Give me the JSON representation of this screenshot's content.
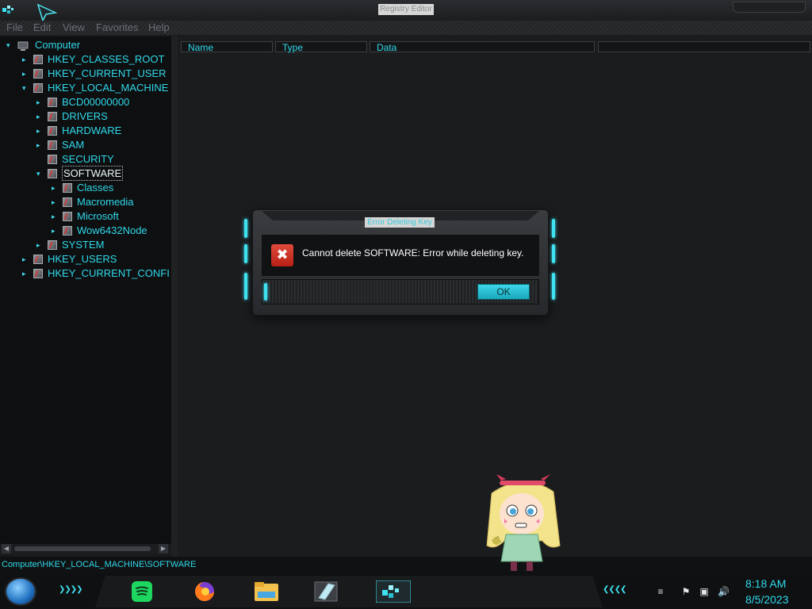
{
  "window": {
    "title": "Registry Editor"
  },
  "menu": {
    "items": [
      "File",
      "Edit",
      "View",
      "Favorites",
      "Help"
    ]
  },
  "tree": {
    "root": "Computer",
    "items": [
      {
        "label": "HKEY_CLASSES_ROOT",
        "depth": 1,
        "expanded": false
      },
      {
        "label": "HKEY_CURRENT_USER",
        "depth": 1,
        "expanded": false
      },
      {
        "label": "HKEY_LOCAL_MACHINE",
        "depth": 1,
        "expanded": true
      },
      {
        "label": "BCD00000000",
        "depth": 2,
        "expanded": false
      },
      {
        "label": "DRIVERS",
        "depth": 2,
        "expanded": false
      },
      {
        "label": "HARDWARE",
        "depth": 2,
        "expanded": false
      },
      {
        "label": "SAM",
        "depth": 2,
        "expanded": false
      },
      {
        "label": "SECURITY",
        "depth": 2,
        "expanded": false
      },
      {
        "label": "SOFTWARE",
        "depth": 2,
        "expanded": true,
        "selected": true
      },
      {
        "label": "Classes",
        "depth": 3,
        "expanded": false
      },
      {
        "label": "Macromedia",
        "depth": 3,
        "expanded": false
      },
      {
        "label": "Microsoft",
        "depth": 3,
        "expanded": false
      },
      {
        "label": "Wow6432Node",
        "depth": 3,
        "expanded": false
      },
      {
        "label": "SYSTEM",
        "depth": 2,
        "expanded": false
      },
      {
        "label": "HKEY_USERS",
        "depth": 1,
        "expanded": false
      },
      {
        "label": "HKEY_CURRENT_CONFI",
        "depth": 1,
        "expanded": false
      }
    ]
  },
  "list": {
    "columns": [
      "Name",
      "Type",
      "Data"
    ]
  },
  "status": {
    "path": "Computer\\HKEY_LOCAL_MACHINE\\SOFTWARE"
  },
  "dialog": {
    "title": "Error Deleting Key",
    "message": "Cannot delete SOFTWARE:  Error while deleting key.",
    "ok_label": "OK",
    "icon": "error-icon"
  },
  "taskbar": {
    "apps": [
      "spotify",
      "firefox",
      "file-explorer",
      "notepad",
      "registry-editor"
    ],
    "tray_icons": [
      "flag-icon",
      "network-icon",
      "volume-icon"
    ],
    "time": "8:18 AM",
    "date": "8/5/2023"
  },
  "colors": {
    "accent": "#2fd8ea",
    "background": "#1b1c1e",
    "error": "#c8281c"
  }
}
